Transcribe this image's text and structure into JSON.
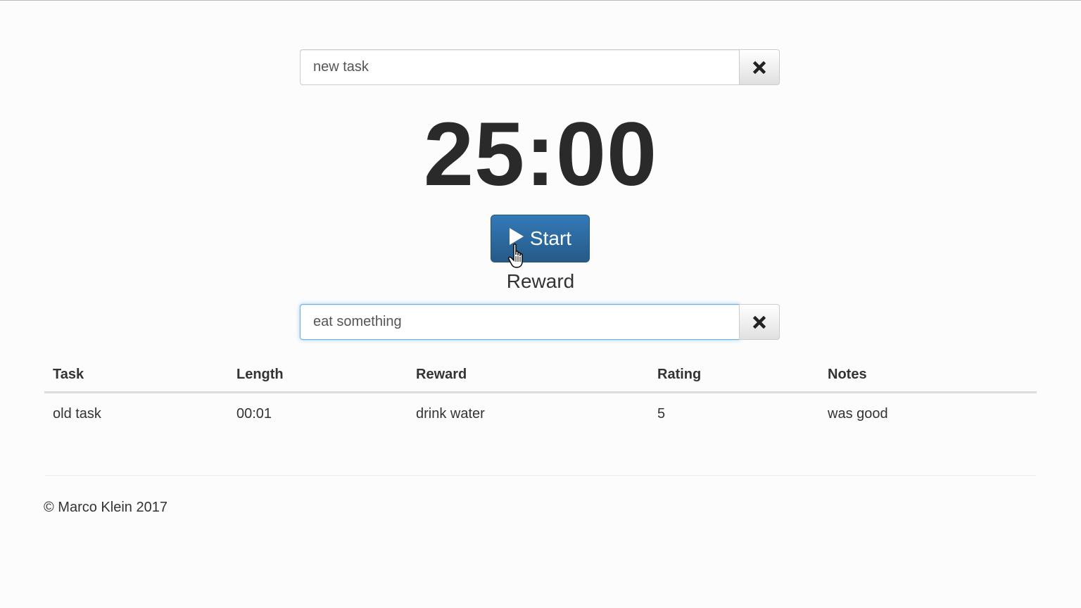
{
  "task": {
    "value": "new task",
    "clear_icon": "times-icon"
  },
  "timer": {
    "display": "25:00"
  },
  "start_button": {
    "icon": "play-icon",
    "label": "Start"
  },
  "reward": {
    "title": "Reward",
    "value": "eat something",
    "clear_icon": "times-icon"
  },
  "history": {
    "headers": [
      "Task",
      "Length",
      "Reward",
      "Rating",
      "Notes"
    ],
    "rows": [
      [
        "old task",
        "00:01",
        "drink water",
        "5",
        "was good"
      ]
    ]
  },
  "footer": {
    "copyright": "© Marco Klein 2017"
  },
  "colors": {
    "primary": "#337ab7",
    "focus": "#66afe9"
  }
}
